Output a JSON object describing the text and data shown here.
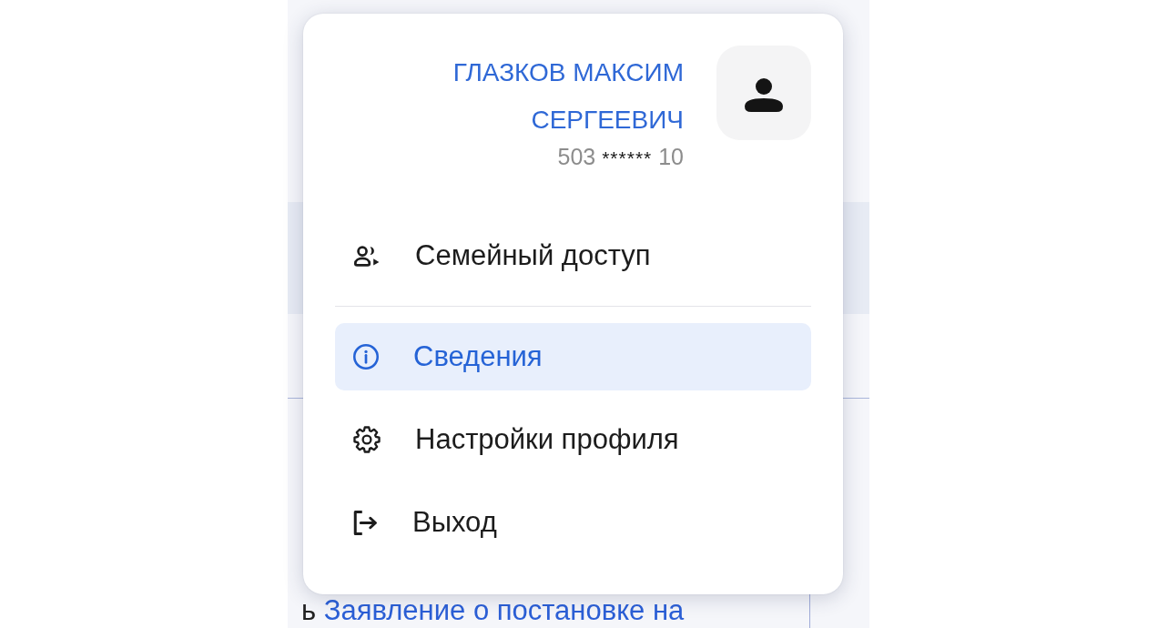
{
  "profile_menu": {
    "user": {
      "name": "ГЛАЗКОВ МАКСИМ СЕРГЕЕВИЧ",
      "phone": {
        "start": "503",
        "masked": "******",
        "end": "10"
      }
    },
    "groups": [
      {
        "items": [
          {
            "kind": "family",
            "label": "Семейный доступ",
            "selected": false
          }
        ]
      },
      {
        "items": [
          {
            "kind": "info",
            "label": "Сведения",
            "selected": true
          },
          {
            "kind": "settings",
            "label": "Настройки профиля",
            "selected": false
          },
          {
            "kind": "logout",
            "label": "Выход",
            "selected": false
          }
        ]
      }
    ]
  },
  "background_page": {
    "text": "ь",
    "link": "Заявление о постановке на"
  }
}
